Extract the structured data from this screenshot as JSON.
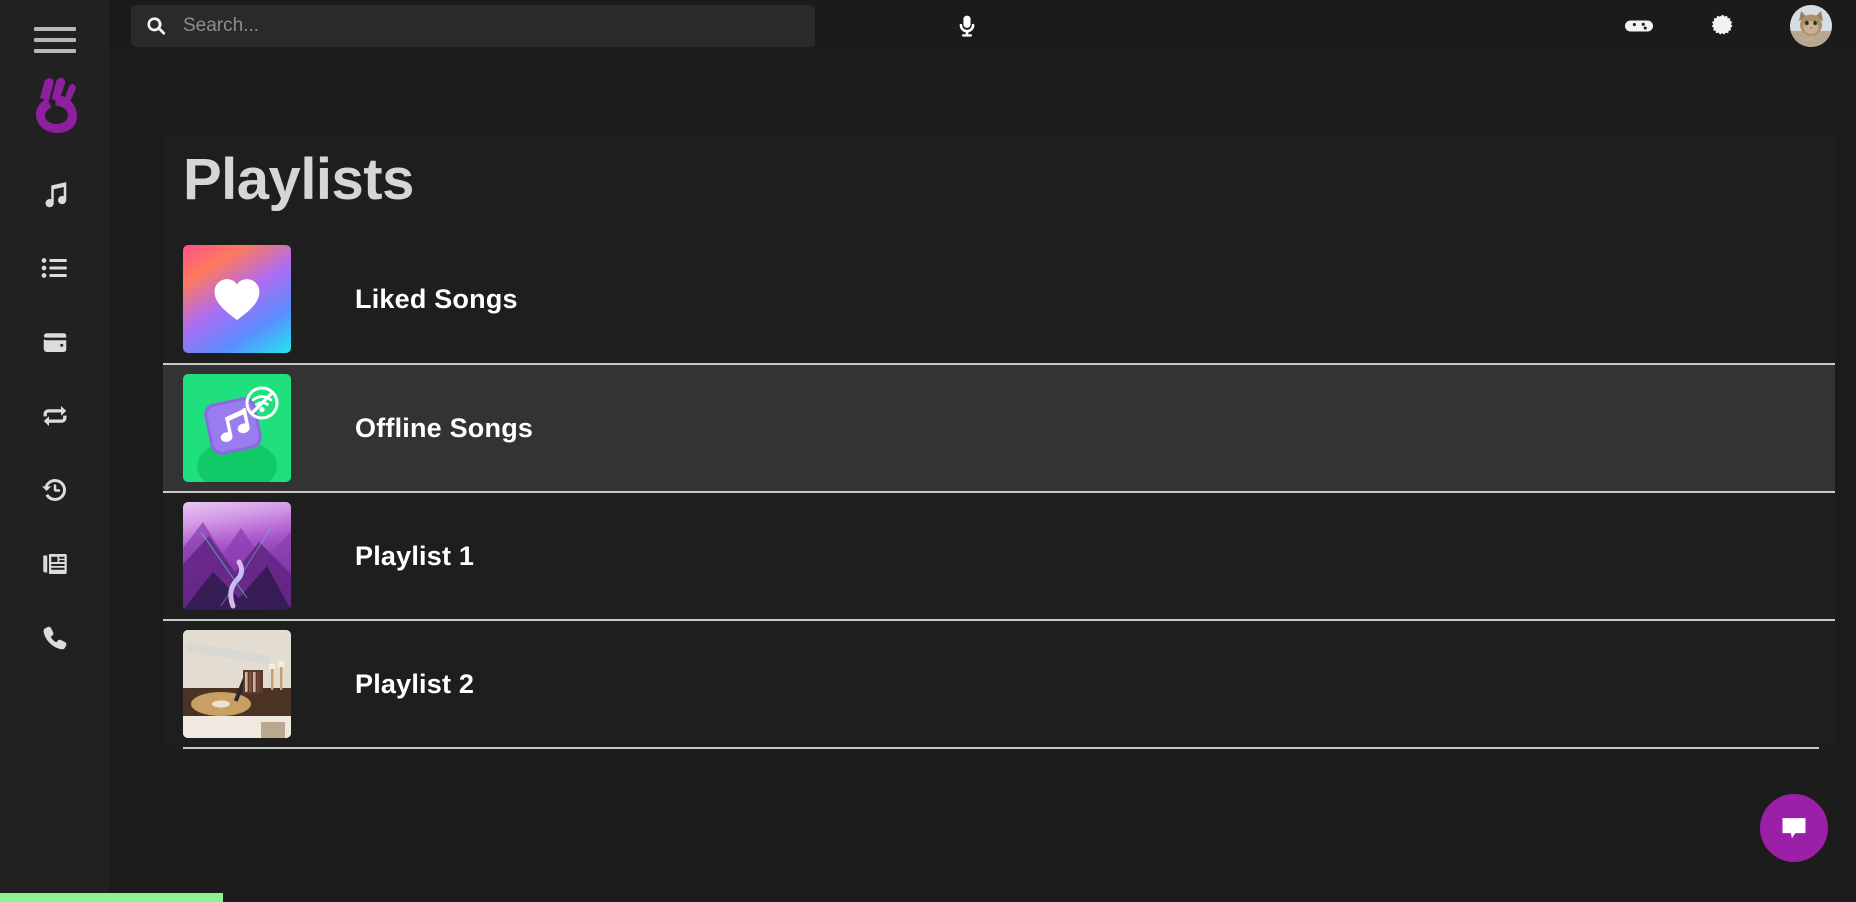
{
  "app": {
    "logo_name": "ok-hand-logo",
    "logo_color": "#8e1f9e",
    "background": "#1c1c1c",
    "accent": "#9c1fa8"
  },
  "sidebar": {
    "menu_button_label": "Menu",
    "items": [
      {
        "label": "Music",
        "icon": "music-note-icon"
      },
      {
        "label": "Playlists",
        "icon": "list-icon"
      },
      {
        "label": "Wallet",
        "icon": "wallet-icon"
      },
      {
        "label": "Repeat",
        "icon": "repeat-icon"
      },
      {
        "label": "History",
        "icon": "history-icon"
      },
      {
        "label": "News",
        "icon": "newspaper-icon"
      },
      {
        "label": "Calls",
        "icon": "phone-icon"
      }
    ]
  },
  "header": {
    "search": {
      "placeholder": "Search...",
      "value": "",
      "icon": "search-icon"
    },
    "mic_icon": "microphone-icon",
    "actions": [
      {
        "name": "games",
        "icon": "gamepad-icon"
      },
      {
        "name": "settings",
        "icon": "gear-icon"
      }
    ],
    "avatar": {
      "name": "user-avatar",
      "alt": "Cat profile picture"
    }
  },
  "main": {
    "title": "Playlists",
    "playlists": [
      {
        "name": "Liked Songs",
        "art": "liked-gradient-heart",
        "active": false
      },
      {
        "name": "Offline Songs",
        "art": "offline-green-note",
        "active": true
      },
      {
        "name": "Playlist 1",
        "art": "purple-mountain-photo",
        "active": false
      },
      {
        "name": "Playlist 2",
        "art": "turntable-photo",
        "active": false
      }
    ]
  },
  "chat_fab": {
    "label": "Chat",
    "icon": "chat-bubble-icon",
    "color": "#9c1fa8"
  },
  "bottom_progress": {
    "percent": 12,
    "color": "#8ef28e"
  }
}
